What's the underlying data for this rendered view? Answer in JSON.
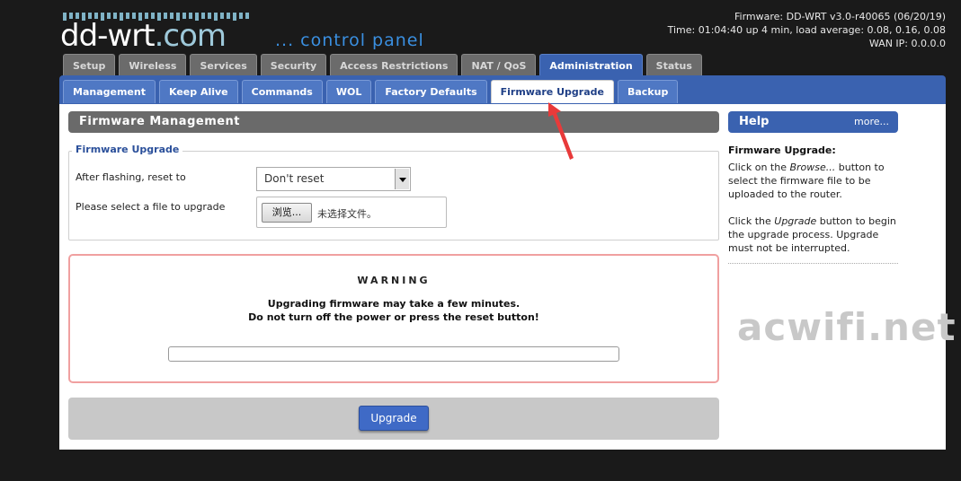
{
  "logo": {
    "main": "dd-wrt",
    "com": ".com",
    "tagline": "... control panel"
  },
  "sysinfo": {
    "firmware": "Firmware: DD-WRT v3.0-r40065 (06/20/19)",
    "time": "Time: 01:04:40 up 4 min, load average: 0.08, 0.16, 0.08",
    "wan": "WAN IP: 0.0.0.0"
  },
  "main_tabs": [
    "Setup",
    "Wireless",
    "Services",
    "Security",
    "Access Restrictions",
    "NAT / QoS",
    "Administration",
    "Status"
  ],
  "sub_tabs": [
    "Management",
    "Keep Alive",
    "Commands",
    "WOL",
    "Factory Defaults",
    "Firmware Upgrade",
    "Backup"
  ],
  "section": {
    "title": "Firmware Management",
    "legend": "Firmware Upgrade",
    "reset_label": "After flashing, reset to",
    "reset_value": "Don't reset",
    "file_label": "Please select a file to upgrade",
    "browse": "浏览...",
    "no_file": "未选择文件。"
  },
  "warning": {
    "title": "WARNING",
    "line1": "Upgrading firmware may take a few minutes.",
    "line2": "Do not turn off the power or press the reset button!",
    "progress": 0
  },
  "actions": {
    "upgrade": "Upgrade"
  },
  "help": {
    "head": "Help",
    "more": "more...",
    "title": "Firmware Upgrade:",
    "p1_a": "Click on the ",
    "p1_em": "Browse...",
    "p1_b": " button to select the firmware file to be uploaded to the router.",
    "p2_a": "Click the ",
    "p2_em": "Upgrade",
    "p2_b": " button to begin the upgrade process. Upgrade must not be interrupted."
  },
  "watermark": "acwifi.net",
  "colors": {
    "accent": "#3a62b0",
    "warning_border": "#f0a0a0",
    "annotation": "#e83a3a"
  }
}
